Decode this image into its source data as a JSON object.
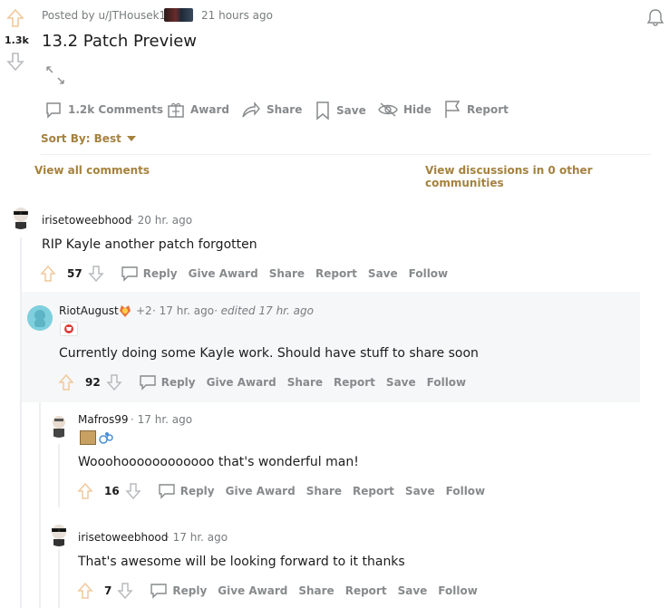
{
  "post": {
    "posted_by": "Posted by u/JTHousek1",
    "time": "21 hours ago",
    "score": "1.3k",
    "title": "13.2 Patch Preview",
    "actions": {
      "comments": "1.2k Comments",
      "award": "Award",
      "share": "Share",
      "save": "Save",
      "hide": "Hide",
      "report": "Report"
    },
    "sort_label": "Sort By: Best",
    "view_all": "View all comments",
    "view_discussions": "View discussions in 0 other communities"
  },
  "comment_actions": {
    "reply": "Reply",
    "give_award": "Give Award",
    "share": "Share",
    "report": "Report",
    "save": "Save",
    "follow": "Follow"
  },
  "comments": [
    {
      "user": "irisetoweebhood",
      "time": "· 20 hr. ago",
      "body": "RIP Kayle another patch forgotten",
      "score": "57"
    },
    {
      "user": "RiotAugust",
      "awards": "+2",
      "time": "· 17 hr. ago",
      "edited": "· edited 17 hr. ago",
      "body": "Currently doing some Kayle work. Should have stuff to share soon",
      "score": "92"
    },
    {
      "user": "Mafros99",
      "time": "· 17 hr. ago",
      "body": "Wooohoooooooooooo that's wonderful man!",
      "score": "16"
    },
    {
      "user": "irisetoweebhood",
      "time": "· 17 hr. ago",
      "body": "That's awesome will be looking forward to it thanks",
      "score": "7"
    }
  ],
  "colors": {
    "accent": "#a5823f",
    "highlight_bg": "#f6f7f8",
    "muted": "#878a8c"
  }
}
